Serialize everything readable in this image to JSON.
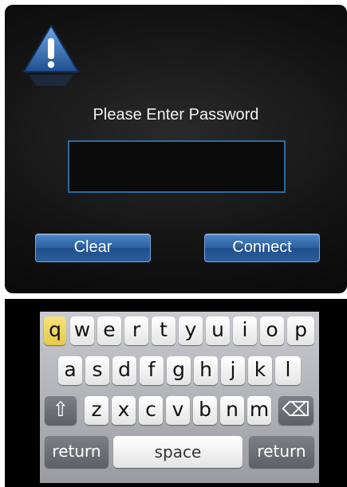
{
  "dialog": {
    "title": "Please Enter Password",
    "password_value": "",
    "clear_label": "Clear",
    "connect_label": "Connect"
  },
  "keyboard": {
    "row1": [
      "q",
      "w",
      "e",
      "r",
      "t",
      "y",
      "u",
      "i",
      "o",
      "p"
    ],
    "row2": [
      "a",
      "s",
      "d",
      "f",
      "g",
      "h",
      "j",
      "k",
      "l"
    ],
    "row3": [
      "z",
      "x",
      "c",
      "v",
      "b",
      "n",
      "m"
    ],
    "shift_glyph": "⇧",
    "backspace_glyph": "⌫",
    "return_label": "return",
    "space_label": "space",
    "highlighted_key": "q",
    "colors": {
      "highlight": "#f0d660",
      "accent": "#2f6aa0"
    }
  }
}
